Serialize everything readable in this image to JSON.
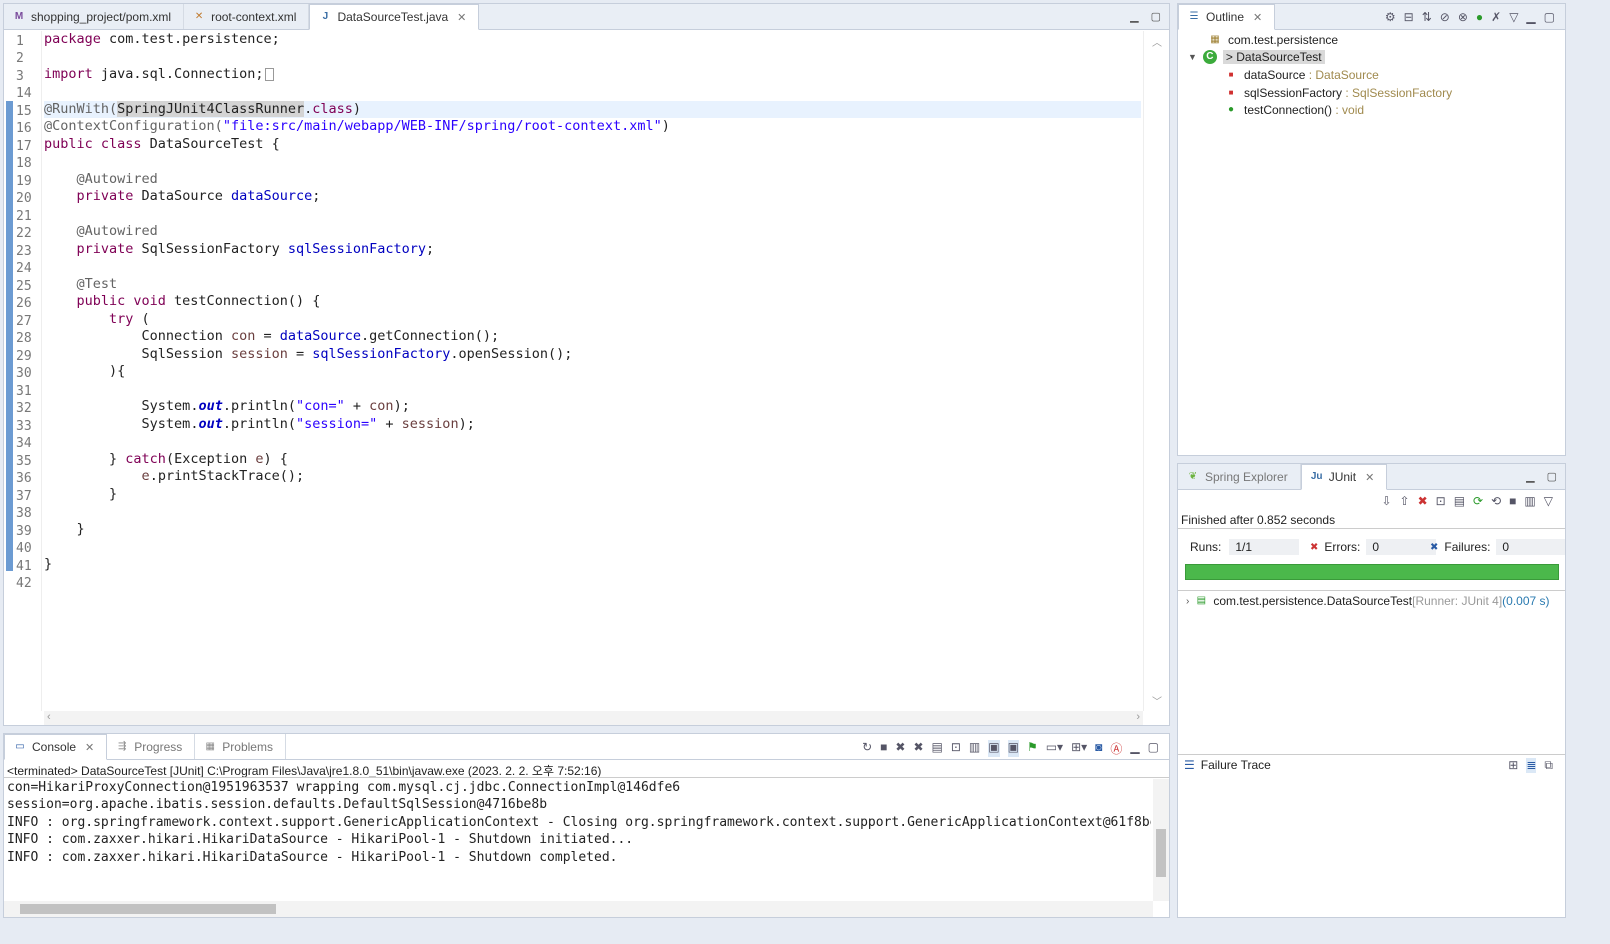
{
  "editor": {
    "tabs": [
      {
        "label": "shopping_project/pom.xml",
        "icon": "maven-file-icon"
      },
      {
        "label": "root-context.xml",
        "icon": "xml-file-icon"
      },
      {
        "label": "DataSourceTest.java",
        "icon": "java-file-icon",
        "active": true
      }
    ],
    "line_numbers": [
      "1",
      "2",
      "3",
      "14",
      "15",
      "16",
      "17",
      "18",
      "19",
      "20",
      "21",
      "22",
      "23",
      "24",
      "25",
      "26",
      "27",
      "28",
      "29",
      "30",
      "31",
      "32",
      "33",
      "34",
      "35",
      "36",
      "37",
      "38",
      "39",
      "40",
      "41",
      "42"
    ],
    "code": {
      "l1a": "package",
      "l1b": " com.test.persistence;",
      "l3a": "import",
      "l3b": " java.sql.Connection;",
      "l15a": "@RunWith(",
      "l15b": "SpringJUnit4ClassRunner",
      ".l15c": "",
      "l15c": ".",
      "l15d": "class",
      "l15e": ")",
      "l16a": "@ContextConfiguration(",
      "l16b": "\"file:src/main/webapp/WEB-INF/spring/root-context.xml\"",
      "l16c": ")",
      "l17a": "public class",
      "l17b": " DataSourceTest {",
      "l19": "@Autowired",
      "l20a": "private",
      "l20b": " DataSource ",
      "l20c": "dataSource",
      "l20d": ";",
      "l22": "@Autowired",
      "l23a": "private",
      "l23b": " SqlSessionFactory ",
      "l23c": "sqlSessionFactory",
      "l23d": ";",
      "l25": "@Test",
      "l26a": "public void",
      "l26b": " testConnection() {",
      "l27a": "try",
      "l27b": " (",
      "l28a": "Connection ",
      "l28b": "con",
      "l28c": " = ",
      "l28d": "dataSource",
      "l28e": ".getConnection();",
      "l29a": "SqlSession ",
      "l29b": "session",
      "l29c": " = ",
      "l29d": "sqlSessionFactory",
      "l29e": ".openSession();",
      "l30": "){",
      "l32a": "System.",
      "l32b": "out",
      "l32c": ".println(",
      "l32d": "\"con=\"",
      "l32e": " + ",
      "l32f": "con",
      "l32g": ");",
      "l33a": "System.",
      "l33b": "out",
      "l33c": ".println(",
      "l33d": "\"session=\"",
      "l33e": " + ",
      "l33f": "session",
      "l33g": ");",
      "l35a": "} ",
      "l35b": "catch",
      "l35c": "(Exception ",
      "l35d": "e",
      "l35e": ") {",
      "l36a": "e",
      "l36b": ".printStackTrace();",
      "l37": "}",
      "l39": "}",
      "l41": "}"
    }
  },
  "outline": {
    "tab_label": "Outline",
    "package": "com.test.persistence",
    "class_label": "> DataSourceTest",
    "members": [
      {
        "name": "dataSource",
        "type": " : DataSource",
        "vis": "private"
      },
      {
        "name": "sqlSessionFactory",
        "type": " : SqlSessionFactory",
        "vis": "private"
      },
      {
        "name": "testConnection()",
        "type": " : void",
        "vis": "public"
      }
    ]
  },
  "junit": {
    "tabs": [
      {
        "label": "Spring Explorer"
      },
      {
        "label": "JUnit",
        "active": true
      }
    ],
    "finished": "Finished after 0.852 seconds",
    "runs_label": "Runs:",
    "runs_value": "1/1",
    "errors_label": "Errors:",
    "errors_value": "0",
    "failures_label": "Failures:",
    "failures_value": "0",
    "progress": 1.0,
    "progress_color": "#4bb84b",
    "result_name": "com.test.persistence.DataSourceTest",
    "result_runner": " [Runner: JUnit 4]",
    "result_time": " (0.007 s)",
    "failure_trace_label": "Failure Trace"
  },
  "console": {
    "tabs": [
      {
        "label": "Console",
        "active": true
      },
      {
        "label": "Progress"
      },
      {
        "label": "Problems"
      }
    ],
    "header": "<terminated> DataSourceTest [JUnit] C:\\Program Files\\Java\\jre1.8.0_51\\bin\\javaw.exe (2023. 2. 2. 오후 7:52:16)",
    "lines": [
      "con=HikariProxyConnection@1951963537 wrapping com.mysql.cj.jdbc.ConnectionImpl@146dfe6",
      "session=org.apache.ibatis.session.defaults.DefaultSqlSession@4716be8b",
      "INFO : org.springframework.context.support.GenericApplicationContext - Closing org.springframework.context.support.GenericApplicationContext@61f8be",
      "INFO : com.zaxxer.hikari.HikariDataSource - HikariPool-1 - Shutdown initiated...",
      "INFO : com.zaxxer.hikari.HikariDataSource - HikariPool-1 - Shutdown completed."
    ]
  }
}
